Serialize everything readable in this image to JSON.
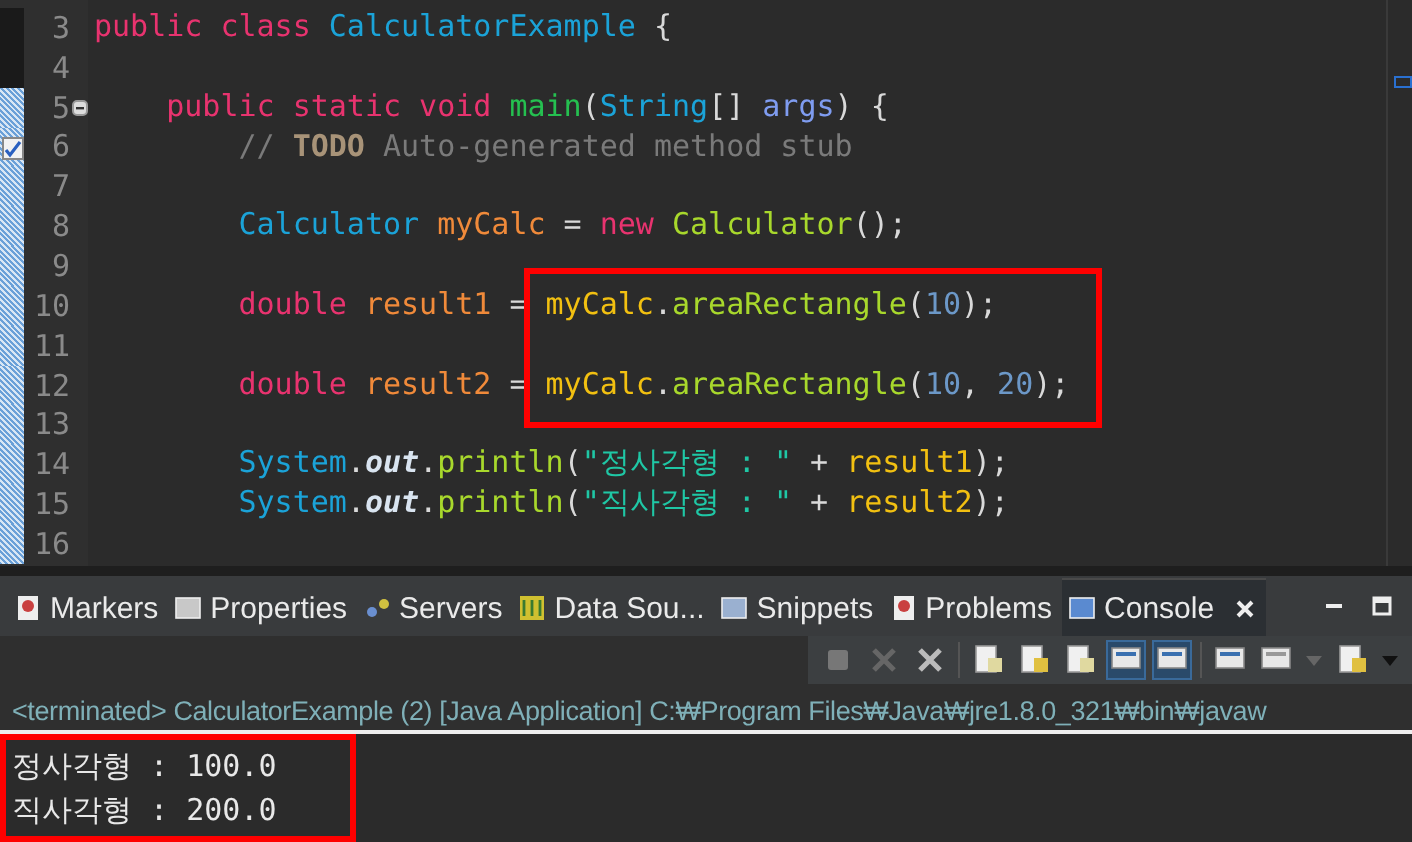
{
  "editor": {
    "lines": [
      {
        "number": "3",
        "kind": "plain",
        "changed": false,
        "tokens": [
          {
            "kind": "kw",
            "text": "public"
          },
          {
            "kind": "kw",
            "text": " class"
          },
          {
            "kind": "type",
            "text": " CalculatorExample"
          },
          {
            "kind": "plain",
            "text": " {"
          }
        ]
      },
      {
        "number": "4",
        "kind": "plain",
        "changed": false
      },
      {
        "number": "5",
        "kind": "fold",
        "changed": true,
        "tokens": [
          {
            "kind": "kw",
            "text": "    public"
          },
          {
            "kind": "kw",
            "text": " static"
          },
          {
            "kind": "kw",
            "text": " void"
          },
          {
            "kind": "decl_method",
            "text": " main"
          },
          {
            "kind": "plain",
            "text": "("
          },
          {
            "kind": "type",
            "text": "String"
          },
          {
            "kind": "plain",
            "text": "[]"
          },
          {
            "kind": "param",
            "text": " args"
          },
          {
            "kind": "plain",
            "text": ") {"
          }
        ]
      },
      {
        "number": "6",
        "kind": "task",
        "changed": true,
        "tokens": [
          {
            "kind": "comment",
            "text": "        //"
          },
          {
            "kind": "todo",
            "text": " TODO"
          },
          {
            "kind": "comment",
            "text": " Auto-generated method stub"
          }
        ]
      },
      {
        "number": "7",
        "kind": "plain",
        "changed": true
      },
      {
        "number": "8",
        "kind": "plain",
        "changed": true,
        "tokens": [
          {
            "kind": "type",
            "text": "        Calculator"
          },
          {
            "kind": "decl",
            "text": " myCalc"
          },
          {
            "kind": "plain",
            "text": " ="
          },
          {
            "kind": "kw",
            "text": " new"
          },
          {
            "kind": "call",
            "text": " Calculator"
          },
          {
            "kind": "plain",
            "text": "();"
          }
        ]
      },
      {
        "number": "9",
        "kind": "plain",
        "changed": true
      },
      {
        "number": "10",
        "kind": "plain",
        "changed": true,
        "tokens": [
          {
            "kind": "kw",
            "text": "        double"
          },
          {
            "kind": "decl",
            "text": " result1"
          },
          {
            "kind": "plain",
            "text": " ="
          },
          {
            "kind": "ref",
            "text": " myCalc"
          },
          {
            "kind": "plain",
            "text": "."
          },
          {
            "kind": "call",
            "text": "areaRectangle"
          },
          {
            "kind": "plain",
            "text": "("
          },
          {
            "kind": "number",
            "text": "10"
          },
          {
            "kind": "plain",
            "text": ");"
          }
        ]
      },
      {
        "number": "11",
        "kind": "plain",
        "changed": true
      },
      {
        "number": "12",
        "kind": "plain",
        "changed": true,
        "tokens": [
          {
            "kind": "kw",
            "text": "        double"
          },
          {
            "kind": "decl",
            "text": " result2"
          },
          {
            "kind": "plain",
            "text": " ="
          },
          {
            "kind": "ref",
            "text": " myCalc"
          },
          {
            "kind": "plain",
            "text": "."
          },
          {
            "kind": "call",
            "text": "areaRectangle"
          },
          {
            "kind": "plain",
            "text": "("
          },
          {
            "kind": "number",
            "text": "10"
          },
          {
            "kind": "plain",
            "text": ","
          },
          {
            "kind": "number",
            "text": " 20"
          },
          {
            "kind": "plain",
            "text": ");"
          }
        ]
      },
      {
        "number": "13",
        "kind": "plain",
        "changed": true
      },
      {
        "number": "14",
        "kind": "plain",
        "changed": true,
        "tokens": [
          {
            "kind": "type",
            "text": "        System"
          },
          {
            "kind": "plain",
            "text": "."
          },
          {
            "kind": "field",
            "text": "out"
          },
          {
            "kind": "plain",
            "text": "."
          },
          {
            "kind": "call",
            "text": "println"
          },
          {
            "kind": "plain",
            "text": "("
          },
          {
            "kind": "string",
            "text": "\"정사각형 : \""
          },
          {
            "kind": "plain",
            "text": " +"
          },
          {
            "kind": "ref",
            "text": " result1"
          },
          {
            "kind": "plain",
            "text": ");"
          }
        ]
      },
      {
        "number": "15",
        "kind": "plain",
        "changed": true,
        "tokens": [
          {
            "kind": "type",
            "text": "        System"
          },
          {
            "kind": "plain",
            "text": "."
          },
          {
            "kind": "field",
            "text": "out"
          },
          {
            "kind": "plain",
            "text": "."
          },
          {
            "kind": "call",
            "text": "println"
          },
          {
            "kind": "plain",
            "text": "("
          },
          {
            "kind": "string",
            "text": "\"직사각형 : \""
          },
          {
            "kind": "plain",
            "text": " +"
          },
          {
            "kind": "ref",
            "text": " result2"
          },
          {
            "kind": "plain",
            "text": ");"
          }
        ]
      },
      {
        "number": "16",
        "kind": "plain",
        "changed": true
      }
    ]
  },
  "panel": {
    "tabs": [
      {
        "label": "Markers",
        "selected": false
      },
      {
        "label": "Properties",
        "selected": false
      },
      {
        "label": "Servers",
        "selected": false
      },
      {
        "label": "Data Sou...",
        "selected": false
      },
      {
        "label": "Snippets",
        "selected": false
      },
      {
        "label": "Problems",
        "selected": false
      },
      {
        "label": "Console",
        "selected": true
      }
    ],
    "console": {
      "header": "<terminated> CalculatorExample (2) [Java Application] C:₩Program Files₩Java₩jre1.8.0_321₩bin₩javaw",
      "output": [
        "정사각형 : 100.0",
        "직사각형 : 200.0"
      ]
    }
  }
}
